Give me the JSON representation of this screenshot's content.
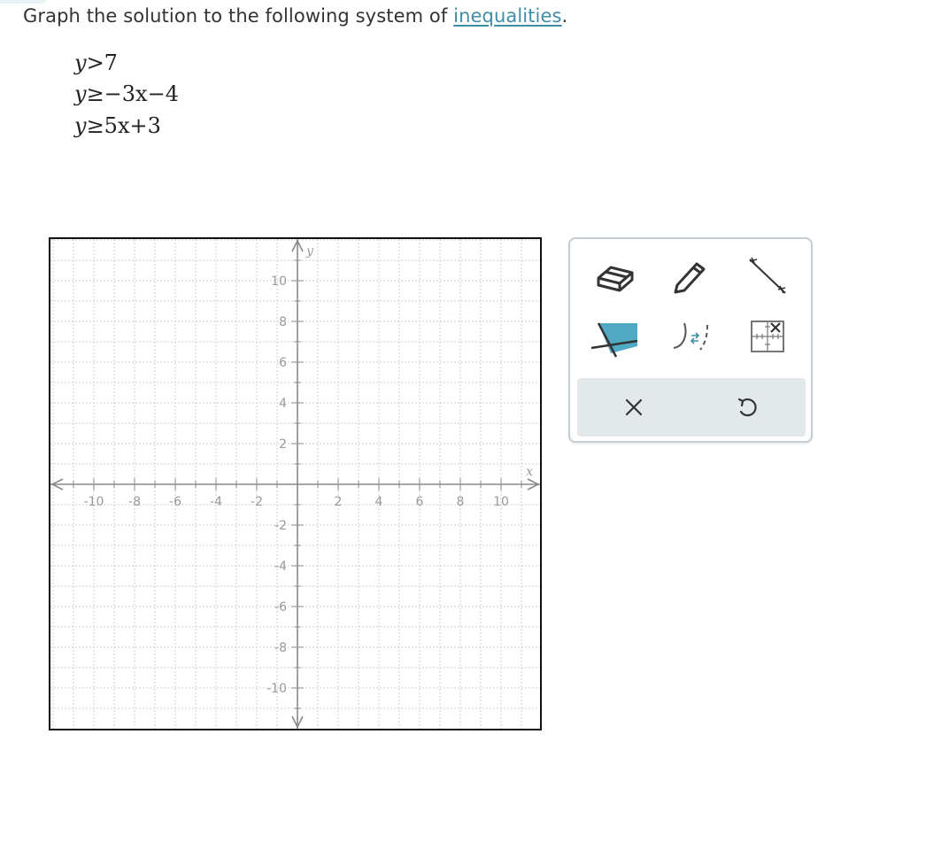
{
  "prompt": {
    "text_before": "Graph the solution to the following system of ",
    "link_text": "inequalities",
    "text_after": "."
  },
  "system": [
    {
      "lhs": "y",
      "op": ">",
      "rhs": "7"
    },
    {
      "lhs": "y",
      "op": "≥",
      "rhs": "−3x−4"
    },
    {
      "lhs": "y",
      "op": "≥",
      "rhs": "5x+3"
    }
  ],
  "graph": {
    "x_axis_label": "x",
    "y_axis_label": "y",
    "x_ticks": [
      "-10",
      "-8",
      "-6",
      "-4",
      "-2",
      "2",
      "4",
      "6",
      "8",
      "10"
    ],
    "y_ticks": [
      "10",
      "8",
      "6",
      "4",
      "2",
      "-2",
      "-4",
      "-6",
      "-8",
      "-10"
    ]
  },
  "toolbar": {
    "tools": [
      "eraser-tool",
      "pencil-tool",
      "line-tool",
      "shade-region-tool",
      "solid-dashed-toggle-tool",
      "clear-graph-tool"
    ],
    "accent_color": "#4fa9c4"
  }
}
